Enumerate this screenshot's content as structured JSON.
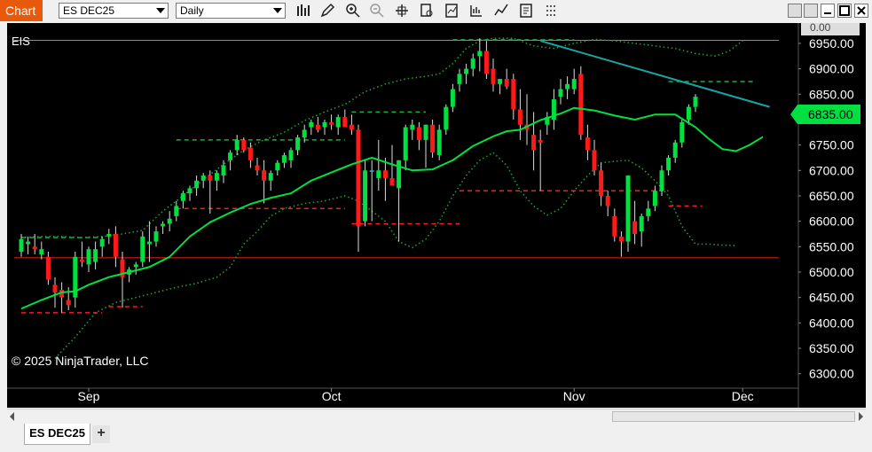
{
  "toolbar": {
    "chart_label": "Chart",
    "instrument_value": "ES DEC25",
    "interval_value": "Daily",
    "icons": [
      "bar-chart-icon",
      "pencil-icon",
      "zoom-in-icon",
      "zoom-out-icon",
      "crosshair-icon",
      "data-box-icon",
      "indicators-icon",
      "strategies-icon",
      "trend-icon",
      "properties-icon",
      "more-icon"
    ]
  },
  "window_controls": [
    "restore-icon",
    "minimize-icon",
    "maximize-icon",
    "close-icon"
  ],
  "chart": {
    "instrument": "EIS",
    "copyright": "© 2025 NinjaTrader, LLC",
    "last_price": "6835.00",
    "top_tag": "0.00",
    "colors": {
      "background": "#000000",
      "up": "#00e040",
      "down": "#ff1a1a",
      "neutral": "#3aa0ff",
      "sma": "#00e040",
      "band": "#1b9e3a",
      "level_red": "#ff1a1a",
      "level_green": "#1fae3a",
      "trendline": "#1aa3a3"
    }
  },
  "chart_data": {
    "type": "candlestick",
    "ylim": [
      6275,
      6990
    ],
    "y_ticks": [
      "6950.00",
      "6900.00",
      "6850.00",
      "6800.00",
      "6750.00",
      "6700.00",
      "6650.00",
      "6600.00",
      "6550.00",
      "6500.00",
      "6450.00",
      "6400.00",
      "6350.00",
      "6300.00"
    ],
    "x_labels": [
      "Sep",
      "Oct",
      "Nov",
      "Dec"
    ],
    "x_label_index": [
      10,
      46,
      82,
      107
    ],
    "candles": [
      {
        "o": 6540,
        "h": 6575,
        "l": 6530,
        "c": 6565
      },
      {
        "o": 6555,
        "h": 6570,
        "l": 6535,
        "c": 6560
      },
      {
        "o": 6550,
        "h": 6575,
        "l": 6535,
        "c": 6545
      },
      {
        "o": 6535,
        "h": 6560,
        "l": 6525,
        "c": 6545
      },
      {
        "o": 6530,
        "h": 6540,
        "l": 6475,
        "c": 6485
      },
      {
        "o": 6475,
        "h": 6490,
        "l": 6430,
        "c": 6460
      },
      {
        "o": 6465,
        "h": 6480,
        "l": 6420,
        "c": 6450
      },
      {
        "o": 6445,
        "h": 6470,
        "l": 6425,
        "c": 6435
      },
      {
        "o": 6450,
        "h": 6540,
        "l": 6430,
        "c": 6530
      },
      {
        "o": 6525,
        "h": 6560,
        "l": 6510,
        "c": 6520
      },
      {
        "o": 6515,
        "h": 6550,
        "l": 6500,
        "c": 6545
      },
      {
        "o": 6520,
        "h": 6560,
        "l": 6505,
        "c": 6545
      },
      {
        "o": 6550,
        "h": 6570,
        "l": 6530,
        "c": 6565
      },
      {
        "o": 6570,
        "h": 6585,
        "l": 6555,
        "c": 6575
      },
      {
        "o": 6575,
        "h": 6590,
        "l": 6510,
        "c": 6530
      },
      {
        "o": 6525,
        "h": 6540,
        "l": 6430,
        "c": 6490
      },
      {
        "o": 6495,
        "h": 6510,
        "l": 6480,
        "c": 6505
      },
      {
        "o": 6510,
        "h": 6520,
        "l": 6495,
        "c": 6515
      },
      {
        "o": 6520,
        "h": 6580,
        "l": 6510,
        "c": 6570
      },
      {
        "o": 6555,
        "h": 6600,
        "l": 6520,
        "c": 6560
      },
      {
        "o": 6560,
        "h": 6590,
        "l": 6550,
        "c": 6580
      },
      {
        "o": 6590,
        "h": 6600,
        "l": 6575,
        "c": 6595
      },
      {
        "o": 6595,
        "h": 6620,
        "l": 6580,
        "c": 6605
      },
      {
        "o": 6610,
        "h": 6640,
        "l": 6600,
        "c": 6630
      },
      {
        "o": 6640,
        "h": 6660,
        "l": 6625,
        "c": 6655
      },
      {
        "o": 6655,
        "h": 6670,
        "l": 6640,
        "c": 6665
      },
      {
        "o": 6665,
        "h": 6690,
        "l": 6650,
        "c": 6680
      },
      {
        "o": 6680,
        "h": 6695,
        "l": 6665,
        "c": 6690
      },
      {
        "o": 6690,
        "h": 6700,
        "l": 6615,
        "c": 6680
      },
      {
        "o": 6680,
        "h": 6700,
        "l": 6660,
        "c": 6695
      },
      {
        "o": 6690,
        "h": 6720,
        "l": 6675,
        "c": 6710
      },
      {
        "o": 6720,
        "h": 6740,
        "l": 6700,
        "c": 6735
      },
      {
        "o": 6740,
        "h": 6770,
        "l": 6730,
        "c": 6760
      },
      {
        "o": 6760,
        "h": 6765,
        "l": 6735,
        "c": 6740
      },
      {
        "o": 6745,
        "h": 6755,
        "l": 6705,
        "c": 6720
      },
      {
        "o": 6710,
        "h": 6725,
        "l": 6690,
        "c": 6700
      },
      {
        "o": 6700,
        "h": 6720,
        "l": 6635,
        "c": 6680
      },
      {
        "o": 6680,
        "h": 6700,
        "l": 6660,
        "c": 6695
      },
      {
        "o": 6700,
        "h": 6720,
        "l": 6690,
        "c": 6715
      },
      {
        "o": 6715,
        "h": 6735,
        "l": 6705,
        "c": 6730
      },
      {
        "o": 6720,
        "h": 6745,
        "l": 6705,
        "c": 6740
      },
      {
        "o": 6740,
        "h": 6770,
        "l": 6730,
        "c": 6765
      },
      {
        "o": 6765,
        "h": 6790,
        "l": 6755,
        "c": 6780
      },
      {
        "o": 6785,
        "h": 6800,
        "l": 6770,
        "c": 6795
      },
      {
        "o": 6790,
        "h": 6805,
        "l": 6775,
        "c": 6780
      },
      {
        "o": 6785,
        "h": 6800,
        "l": 6770,
        "c": 6795
      },
      {
        "o": 6795,
        "h": 6810,
        "l": 6780,
        "c": 6790
      },
      {
        "o": 6785,
        "h": 6810,
        "l": 6770,
        "c": 6805
      },
      {
        "o": 6805,
        "h": 6820,
        "l": 6785,
        "c": 6785
      },
      {
        "o": 6790,
        "h": 6810,
        "l": 6770,
        "c": 6780
      },
      {
        "o": 6780,
        "h": 6790,
        "l": 6540,
        "c": 6590
      },
      {
        "o": 6600,
        "h": 6720,
        "l": 6590,
        "c": 6700
      },
      {
        "o": 6700,
        "h": 6720,
        "l": 6600,
        "c": 6700
      },
      {
        "o": 6685,
        "h": 6760,
        "l": 6660,
        "c": 6700
      },
      {
        "o": 6700,
        "h": 6725,
        "l": 6640,
        "c": 6685
      },
      {
        "o": 6685,
        "h": 6750,
        "l": 6670,
        "c": 6670
      },
      {
        "o": 6665,
        "h": 6720,
        "l": 6560,
        "c": 6720
      },
      {
        "o": 6720,
        "h": 6790,
        "l": 6700,
        "c": 6785
      },
      {
        "o": 6780,
        "h": 6800,
        "l": 6760,
        "c": 6790
      },
      {
        "o": 6785,
        "h": 6795,
        "l": 6740,
        "c": 6760
      },
      {
        "o": 6760,
        "h": 6790,
        "l": 6705,
        "c": 6790
      },
      {
        "o": 6790,
        "h": 6800,
        "l": 6725,
        "c": 6735
      },
      {
        "o": 6730,
        "h": 6790,
        "l": 6720,
        "c": 6780
      },
      {
        "o": 6780,
        "h": 6830,
        "l": 6770,
        "c": 6825
      },
      {
        "o": 6825,
        "h": 6870,
        "l": 6815,
        "c": 6860
      },
      {
        "o": 6870,
        "h": 6900,
        "l": 6855,
        "c": 6890
      },
      {
        "o": 6890,
        "h": 6910,
        "l": 6870,
        "c": 6900
      },
      {
        "o": 6900,
        "h": 6930,
        "l": 6885,
        "c": 6920
      },
      {
        "o": 6925,
        "h": 6960,
        "l": 6895,
        "c": 6935
      },
      {
        "o": 6935,
        "h": 6955,
        "l": 6880,
        "c": 6890
      },
      {
        "o": 6900,
        "h": 6920,
        "l": 6855,
        "c": 6870
      },
      {
        "o": 6870,
        "h": 6880,
        "l": 6850,
        "c": 6880
      },
      {
        "o": 6880,
        "h": 6900,
        "l": 6860,
        "c": 6865
      },
      {
        "o": 6880,
        "h": 6890,
        "l": 6800,
        "c": 6820
      },
      {
        "o": 6820,
        "h": 6860,
        "l": 6760,
        "c": 6790
      },
      {
        "o": 6790,
        "h": 6850,
        "l": 6750,
        "c": 6780
      },
      {
        "o": 6770,
        "h": 6815,
        "l": 6700,
        "c": 6740
      },
      {
        "o": 6760,
        "h": 6780,
        "l": 6660,
        "c": 6755
      },
      {
        "o": 6790,
        "h": 6815,
        "l": 6770,
        "c": 6805
      },
      {
        "o": 6800,
        "h": 6860,
        "l": 6780,
        "c": 6840
      },
      {
        "o": 6845,
        "h": 6880,
        "l": 6830,
        "c": 6860
      },
      {
        "o": 6860,
        "h": 6885,
        "l": 6840,
        "c": 6870
      },
      {
        "o": 6860,
        "h": 6900,
        "l": 6850,
        "c": 6880
      },
      {
        "o": 6890,
        "h": 6905,
        "l": 6760,
        "c": 6770
      },
      {
        "o": 6765,
        "h": 6790,
        "l": 6720,
        "c": 6740
      },
      {
        "o": 6740,
        "h": 6760,
        "l": 6690,
        "c": 6700
      },
      {
        "o": 6700,
        "h": 6715,
        "l": 6630,
        "c": 6650
      },
      {
        "o": 6650,
        "h": 6660,
        "l": 6610,
        "c": 6630
      },
      {
        "o": 6610,
        "h": 6625,
        "l": 6560,
        "c": 6570
      },
      {
        "o": 6570,
        "h": 6580,
        "l": 6530,
        "c": 6560
      },
      {
        "o": 6560,
        "h": 6690,
        "l": 6540,
        "c": 6690
      },
      {
        "o": 6600,
        "h": 6640,
        "l": 6555,
        "c": 6575
      },
      {
        "o": 6580,
        "h": 6615,
        "l": 6550,
        "c": 6610
      },
      {
        "o": 6610,
        "h": 6640,
        "l": 6600,
        "c": 6625
      },
      {
        "o": 6630,
        "h": 6670,
        "l": 6620,
        "c": 6660
      },
      {
        "o": 6660,
        "h": 6710,
        "l": 6650,
        "c": 6700
      },
      {
        "o": 6700,
        "h": 6730,
        "l": 6690,
        "c": 6725
      },
      {
        "o": 6725,
        "h": 6760,
        "l": 6715,
        "c": 6755
      },
      {
        "o": 6755,
        "h": 6800,
        "l": 6745,
        "c": 6795
      },
      {
        "o": 6800,
        "h": 6830,
        "l": 6790,
        "c": 6825
      },
      {
        "o": 6825,
        "h": 6850,
        "l": 6815,
        "c": 6845
      }
    ],
    "sma": [
      [
        0,
        6428
      ],
      [
        3,
        6445
      ],
      [
        6,
        6460
      ],
      [
        8,
        6462
      ],
      [
        10,
        6475
      ],
      [
        13,
        6490
      ],
      [
        16,
        6500
      ],
      [
        19,
        6510
      ],
      [
        22,
        6530
      ],
      [
        25,
        6570
      ],
      [
        28,
        6598
      ],
      [
        31,
        6617
      ],
      [
        34,
        6634
      ],
      [
        37,
        6646
      ],
      [
        40,
        6655
      ],
      [
        43,
        6680
      ],
      [
        46,
        6696
      ],
      [
        49,
        6712
      ],
      [
        52,
        6725
      ],
      [
        55,
        6712
      ],
      [
        58,
        6700
      ],
      [
        61,
        6702
      ],
      [
        64,
        6720
      ],
      [
        67,
        6748
      ],
      [
        70,
        6767
      ],
      [
        72,
        6777
      ],
      [
        74,
        6780
      ],
      [
        77,
        6799
      ],
      [
        80,
        6812
      ],
      [
        82,
        6823
      ],
      [
        85,
        6818
      ],
      [
        88,
        6808
      ],
      [
        91,
        6800
      ],
      [
        94,
        6810
      ],
      [
        97,
        6810
      ],
      [
        100,
        6785
      ],
      [
        102,
        6762
      ],
      [
        104,
        6742
      ],
      [
        106,
        6738
      ],
      [
        108,
        6750
      ],
      [
        110,
        6766
      ]
    ],
    "upper_band": [
      [
        0,
        6568
      ],
      [
        3,
        6570
      ],
      [
        6,
        6570
      ],
      [
        9,
        6568
      ],
      [
        12,
        6570
      ],
      [
        15,
        6575
      ],
      [
        18,
        6582
      ],
      [
        21,
        6620
      ],
      [
        24,
        6650
      ],
      [
        27,
        6682
      ],
      [
        30,
        6712
      ],
      [
        33,
        6740
      ],
      [
        36,
        6760
      ],
      [
        39,
        6775
      ],
      [
        42,
        6798
      ],
      [
        45,
        6815
      ],
      [
        48,
        6830
      ],
      [
        51,
        6855
      ],
      [
        54,
        6870
      ],
      [
        57,
        6880
      ],
      [
        60,
        6885
      ],
      [
        62,
        6890
      ],
      [
        64,
        6910
      ],
      [
        66,
        6940
      ],
      [
        68,
        6955
      ],
      [
        70,
        6960
      ],
      [
        73,
        6960
      ],
      [
        76,
        6945
      ],
      [
        79,
        6940
      ],
      [
        82,
        6950
      ],
      [
        85,
        6958
      ],
      [
        88,
        6955
      ],
      [
        91,
        6950
      ],
      [
        94,
        6945
      ],
      [
        97,
        6940
      ],
      [
        100,
        6930
      ],
      [
        103,
        6925
      ],
      [
        105,
        6935
      ],
      [
        107,
        6955
      ]
    ],
    "lower_band": [
      [
        5,
        6330
      ],
      [
        8,
        6372
      ],
      [
        11,
        6420
      ],
      [
        14,
        6440
      ],
      [
        17,
        6450
      ],
      [
        20,
        6460
      ],
      [
        23,
        6470
      ],
      [
        26,
        6478
      ],
      [
        29,
        6490
      ],
      [
        31,
        6510
      ],
      [
        33,
        6555
      ],
      [
        35,
        6580
      ],
      [
        37,
        6610
      ],
      [
        39,
        6625
      ],
      [
        42,
        6635
      ],
      [
        45,
        6640
      ],
      [
        48,
        6650
      ],
      [
        50,
        6640
      ],
      [
        52,
        6620
      ],
      [
        54,
        6600
      ],
      [
        56,
        6560
      ],
      [
        58,
        6548
      ],
      [
        60,
        6565
      ],
      [
        62,
        6600
      ],
      [
        64,
        6650
      ],
      [
        66,
        6690
      ],
      [
        68,
        6720
      ],
      [
        70,
        6735
      ],
      [
        72,
        6710
      ],
      [
        74,
        6660
      ],
      [
        76,
        6630
      ],
      [
        78,
        6612
      ],
      [
        80,
        6625
      ],
      [
        82,
        6660
      ],
      [
        84,
        6690
      ],
      [
        86,
        6715
      ],
      [
        88,
        6718
      ],
      [
        90,
        6720
      ],
      [
        92,
        6705
      ],
      [
        94,
        6680
      ],
      [
        96,
        6650
      ],
      [
        98,
        6590
      ],
      [
        100,
        6555
      ],
      [
        102,
        6555
      ],
      [
        104,
        6553
      ],
      [
        106,
        6552
      ]
    ],
    "levels": [
      {
        "type": "solid",
        "color": "green",
        "y": 6956,
        "x0": 0,
        "x1": 110
      },
      {
        "type": "solid",
        "color": "red",
        "y": 6528,
        "x0": 0,
        "x1": 110
      },
      {
        "type": "dash",
        "color": "green",
        "y": 6568,
        "x0": 0,
        "x1": 12
      },
      {
        "type": "dash",
        "color": "green",
        "y": 6760,
        "x0": 23,
        "x1": 48
      },
      {
        "type": "dash",
        "color": "green",
        "y": 6815,
        "x0": 49,
        "x1": 60
      },
      {
        "type": "dash",
        "color": "green",
        "y": 6957,
        "x0": 64,
        "x1": 82
      },
      {
        "type": "dash",
        "color": "green",
        "y": 6875,
        "x0": 96,
        "x1": 109
      },
      {
        "type": "dash",
        "color": "red",
        "y": 6420,
        "x0": 0,
        "x1": 12
      },
      {
        "type": "dash",
        "color": "red",
        "y": 6432,
        "x0": 13,
        "x1": 18
      },
      {
        "type": "dash",
        "color": "red",
        "y": 6625,
        "x0": 23,
        "x1": 48
      },
      {
        "type": "dash",
        "color": "red",
        "y": 6595,
        "x0": 49,
        "x1": 65
      },
      {
        "type": "dash",
        "color": "red",
        "y": 6660,
        "x0": 65,
        "x1": 96
      },
      {
        "type": "dash",
        "color": "red",
        "y": 6630,
        "x0": 96,
        "x1": 101
      }
    ],
    "trendline": {
      "x0": 77,
      "y0": 6955,
      "x1": 111,
      "y1": 6825
    }
  }
}
